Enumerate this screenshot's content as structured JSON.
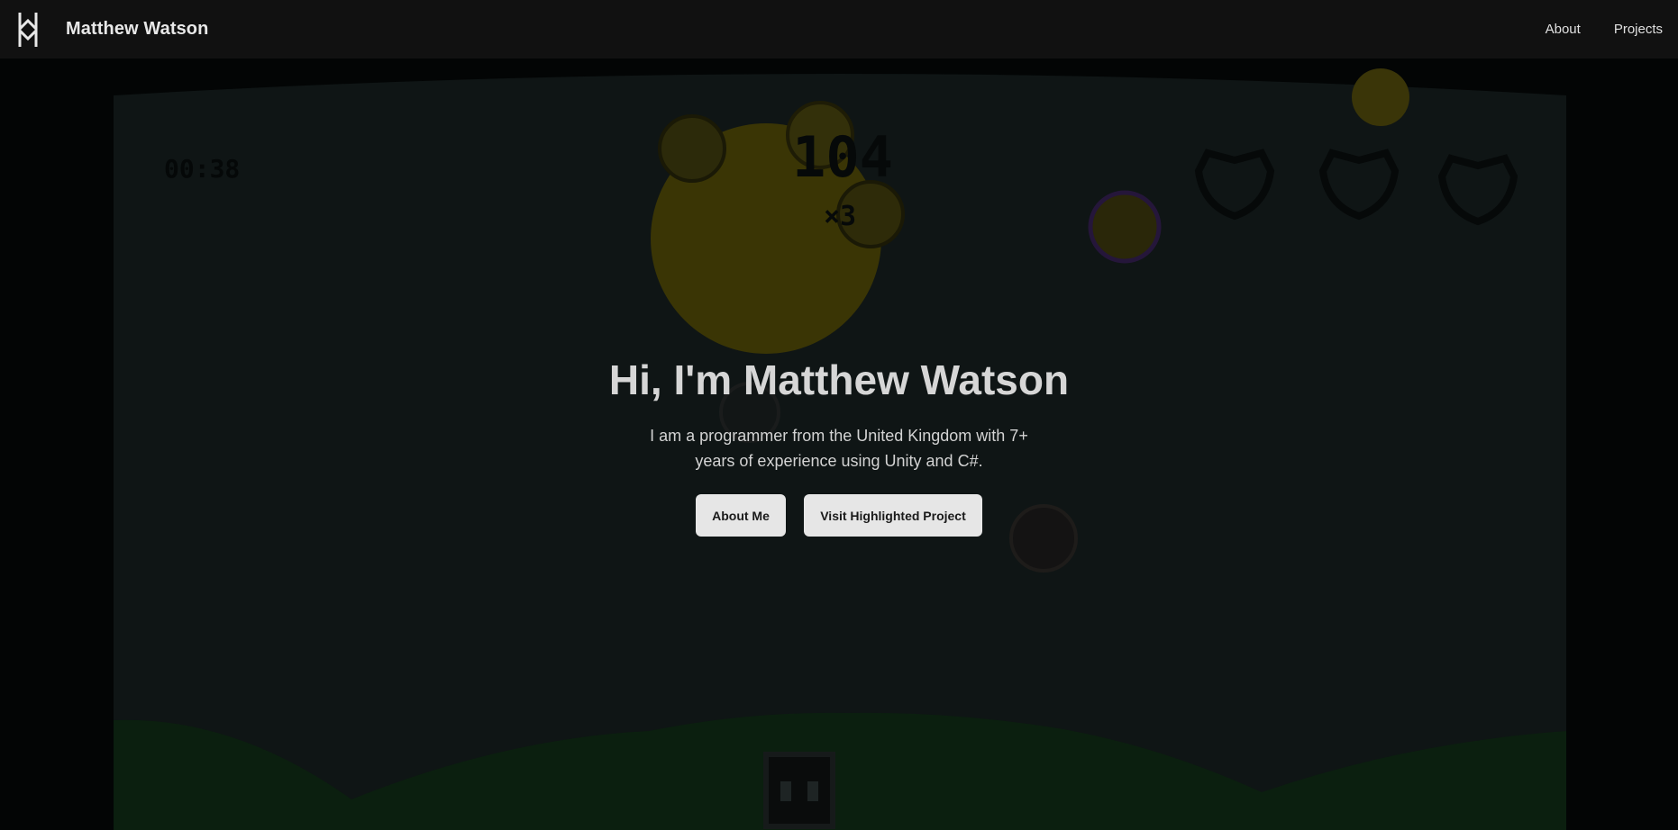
{
  "nav": {
    "brand_name": "Matthew Watson",
    "links": [
      {
        "label": "About"
      },
      {
        "label": "Projects"
      }
    ]
  },
  "game": {
    "timer": "00:38",
    "score": "104",
    "multiplier": "×3",
    "lives": 3
  },
  "hero": {
    "title": "Hi, I'm Matthew Watson",
    "subtitle": "I am a programmer from the United Kingdom with 7+ years of experience using Unity and C#.",
    "buttons": {
      "about": "About Me",
      "project": "Visit Highlighted Project"
    }
  },
  "colors": {
    "navbar": "#111111",
    "game_sky": "#0f1515",
    "ground": "#0b1f0f",
    "button_bg": "#e6e6e6",
    "title_text": "#d6d6d6",
    "sun": "#3a3505"
  }
}
